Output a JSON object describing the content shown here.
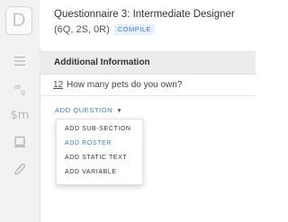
{
  "app": {
    "logo_letter": "D"
  },
  "header": {
    "title": "Questionnaire 3: Intermediate Designer",
    "subtitle": "(6Q, 2S, 0R)",
    "compile_label": "COMPILE"
  },
  "sidebar": {
    "items": [
      {
        "icon": "menu-icon"
      },
      {
        "icon": "variables-icon",
        "text": "₃₂"
      },
      {
        "icon": "macros-icon",
        "text": "$m"
      },
      {
        "icon": "display-icon"
      },
      {
        "icon": "attachment-icon"
      }
    ]
  },
  "section": {
    "title": "Additional Information"
  },
  "question": {
    "number": "12",
    "text": "How many pets do you own?"
  },
  "add_question": {
    "label": "ADD QUESTION",
    "menu": [
      "ADD SUB-SECTION",
      "ADD ROSTER",
      "ADD STATIC TEXT",
      "ADD VARIABLE"
    ]
  },
  "colors": {
    "accent": "#3a7bd5",
    "sidebar_bg": "#f2f2f2",
    "section_bg": "#ececec"
  }
}
